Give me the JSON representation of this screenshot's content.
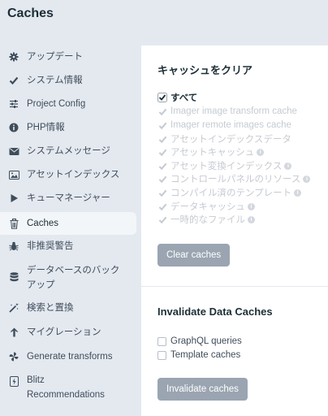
{
  "header": {
    "title": "Caches"
  },
  "sidebar": {
    "items": [
      {
        "label": "アップデート",
        "icon": "gear-icon"
      },
      {
        "label": "システム情報",
        "icon": "check-icon"
      },
      {
        "label": "Project Config",
        "icon": "sliders-icon"
      },
      {
        "label": "PHP情報",
        "icon": "info-icon"
      },
      {
        "label": "システムメッセージ",
        "icon": "envelope-icon"
      },
      {
        "label": "アセットインデックス",
        "icon": "image-icon"
      },
      {
        "label": "キューマネージャー",
        "icon": "play-icon"
      },
      {
        "label": "Caches",
        "icon": "trash-icon",
        "active": true
      },
      {
        "label": "非推奨警告",
        "icon": "bug-icon"
      },
      {
        "label": "データベースのバックアップ",
        "label_line1": "データベースのバック",
        "label_line2": "アップ",
        "icon": "database-icon"
      },
      {
        "label": "検索と置換",
        "icon": "wand-icon"
      },
      {
        "label": "マイグレーション",
        "icon": "arrow-up-icon"
      },
      {
        "label": "Generate transforms",
        "icon": "pinwheel-icon"
      },
      {
        "label": "Blitz Recommendations",
        "label_line1": "Blitz",
        "label_line2": "Recommendations",
        "icon": "blitz-icon"
      }
    ]
  },
  "clear_caches": {
    "title": "キャッシュをクリア",
    "all_label": "すべて",
    "options": [
      {
        "label": "Imager image transform cache",
        "info": false
      },
      {
        "label": "Imager remote images cache",
        "info": false
      },
      {
        "label": "アセットインデックスデータ",
        "info": false
      },
      {
        "label": "アセットキャッシュ",
        "info": true
      },
      {
        "label": "アセット変換インデックス",
        "info": true
      },
      {
        "label": "コントロールパネルのリソース",
        "info": true
      },
      {
        "label": "コンパイル済のテンプレート",
        "info": true
      },
      {
        "label": "データキャッシュ",
        "info": true
      },
      {
        "label": "一時的なファイル",
        "info": true
      }
    ],
    "button": "Clear caches"
  },
  "invalidate": {
    "title": "Invalidate Data Caches",
    "options": [
      {
        "label": "GraphQL queries",
        "checked": false
      },
      {
        "label": "Template caches",
        "checked": false
      }
    ],
    "button": "Invalidate caches"
  },
  "colors": {
    "sidebar_bg": "#e4e9f0",
    "panel_bg": "#ffffff",
    "button_bg": "#9aa5b1",
    "disabled_text": "#c5cbd2"
  }
}
